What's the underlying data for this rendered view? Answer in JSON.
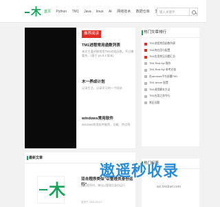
{
  "header": {
    "logo_text": "木",
    "nav": [
      "首页",
      "Python",
      "TM1",
      "Java",
      "linux",
      "AI",
      "网络技术",
      "数据仓库",
      "生活",
      "趣玩",
      "关于"
    ],
    "search_placeholder": "输入关键字"
  },
  "recommend": {
    "tag": "推荐阅读",
    "items": [
      {
        "title": "TM1进程常用函数列表",
        "desc": "本文主要讲解常用TM1进程函数，不过需要先... (基于 pa 8.3 版本)"
      },
      {
        "title": "木一养成计划",
        "desc": "记录生活、记录学习的一个网站"
      },
      {
        "title": "windows常用软件",
        "desc": "windows常用软件推荐，功能、特点等"
      }
    ]
  },
  "hot": {
    "title": "热门文章排行",
    "items": [
      "TM1进程常用函数列表",
      "TM1的应用与配置",
      "TM1应用常见问题汇总",
      "TM1 Rest Api 操作",
      "TM1 Rest Api 参考文档",
      "在windows平台部署TM1",
      "TM1 server 配置",
      "TM1调用脚本方法",
      "TM1应用之命令行",
      "常见问题"
    ]
  },
  "tags": {
    "title": "热门标签"
  },
  "latest": {
    "title": "最新文章",
    "article_title": "双击程序类似\"以管理员身份运行\"",
    "article_desc": "双击程序时，弹出以管理员身份运行",
    "article_meta": "发布于 2021-03-01"
  },
  "watermark": {
    "text": "遨遥秒收录",
    "sub": "wz.kmdnet.com"
  }
}
